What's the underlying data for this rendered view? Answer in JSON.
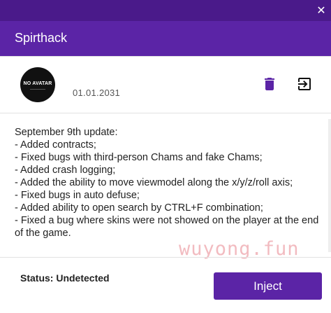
{
  "window": {
    "title": "Spirthack",
    "close_glyph": "✕"
  },
  "profile": {
    "avatar_text": "NO AVATAR",
    "date": "01.01.2031"
  },
  "actions": {
    "delete_icon": "trash-icon",
    "logout_icon": "logout-icon"
  },
  "changelog": {
    "lines": [
      "September 9th update:",
      "- Added contracts;",
      "- Fixed bugs with third-person Chams and fake Chams;",
      "- Added crash logging;",
      "- Added the ability to move viewmodel along the x/y/z/roll axis;",
      "- Fixed bugs in auto defuse;",
      "- Added ability to open search by CTRL+F combination;",
      "- Fixed a bug where skins were not showed on the player at the end",
      "of the game."
    ]
  },
  "watermark": "wuyong.fun",
  "footer": {
    "status": "Status: Undetected",
    "inject_label": "Inject"
  },
  "colors": {
    "titlebar": "#4a1a8a",
    "header": "#5b24a6",
    "accent": "#5b24a6"
  }
}
